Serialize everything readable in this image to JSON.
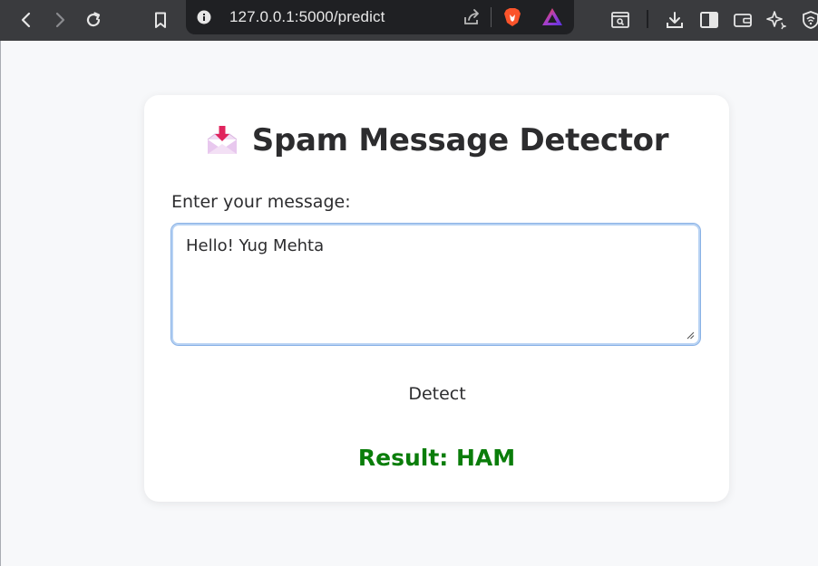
{
  "browser": {
    "url": "127.0.0.1:5000/predict"
  },
  "app": {
    "title_icon": "inbox-tray-icon",
    "title": "Spam Message Detector",
    "message_label": "Enter your message:",
    "message_value": "Hello! Yug Mehta",
    "detect_label": "Detect",
    "result_text": "Result: HAM",
    "result_color": "#0a7d0a"
  },
  "colors": {
    "toolbar_bg": "#3a3b3e",
    "omnibox_bg": "#1f2023",
    "page_bg": "#f7f8fa",
    "card_bg": "#ffffff",
    "focus_border": "#b7d2f3"
  }
}
